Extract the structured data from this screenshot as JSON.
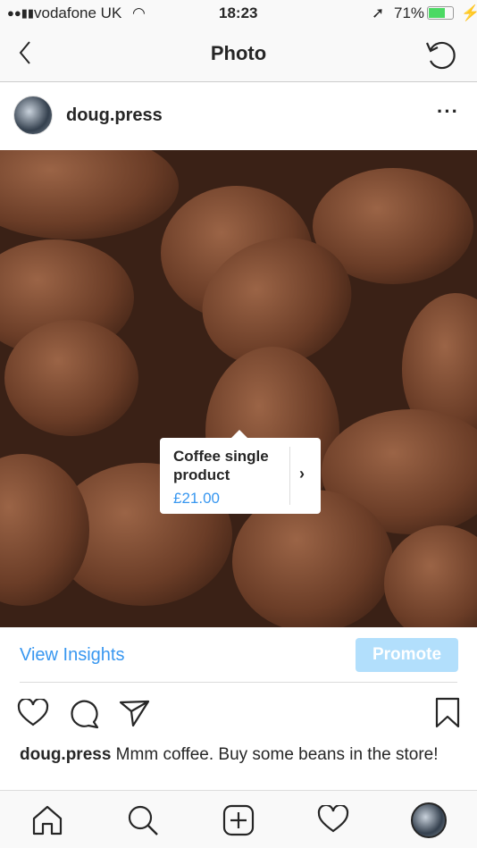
{
  "status": {
    "carrier": "vodafone UK",
    "time": "18:23",
    "battery": "71%",
    "battery_level": 0.71,
    "battery_color": "#4cd964"
  },
  "nav": {
    "title": "Photo"
  },
  "post": {
    "username": "doug.press",
    "caption_user": "doug.press",
    "caption_text": " Mmm coffee. Buy some beans in the store!"
  },
  "product_tag": {
    "name": "Coffee single product",
    "price": "£21.00"
  },
  "actions": {
    "insights": "View Insights",
    "promote": "Promote"
  },
  "colors": {
    "accent": "#3897f0",
    "promote_bg": "#b2dffc"
  }
}
